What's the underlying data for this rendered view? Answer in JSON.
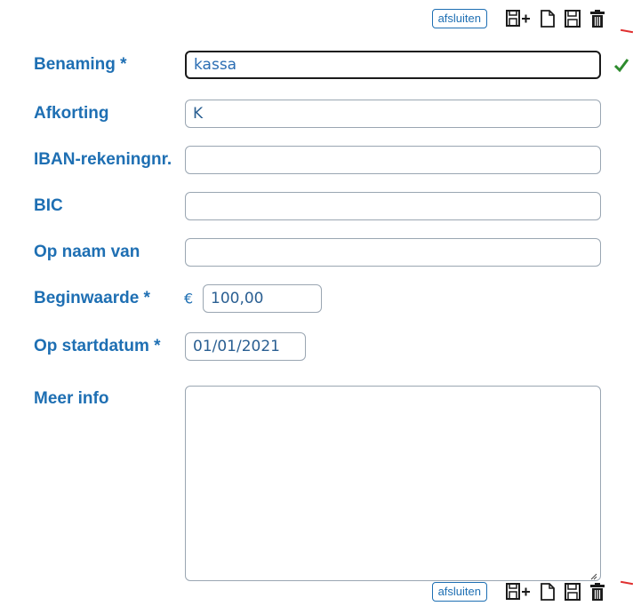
{
  "toolbar": {
    "close_label": "afsluiten",
    "icons": [
      "save-new-icon",
      "new-document-icon",
      "save-icon",
      "trash-icon"
    ]
  },
  "form": {
    "benaming": {
      "label": "Benaming *",
      "value": "kassa"
    },
    "afkorting": {
      "label": "Afkorting",
      "value": "K"
    },
    "iban": {
      "label": "IBAN-rekeningnr.",
      "value": ""
    },
    "bic": {
      "label": "BIC",
      "value": ""
    },
    "op_naam_van": {
      "label": "Op naam van",
      "value": ""
    },
    "beginwaarde": {
      "label": "Beginwaarde *",
      "currency": "€",
      "value": "100,00"
    },
    "op_startdatum": {
      "label": "Op startdatum *",
      "value": "01/01/2021"
    },
    "meer_info": {
      "label": "Meer info",
      "value": ""
    }
  },
  "colors": {
    "label": "#1e6fb3",
    "check": "#2e8b2e",
    "mark": "#e03030"
  }
}
